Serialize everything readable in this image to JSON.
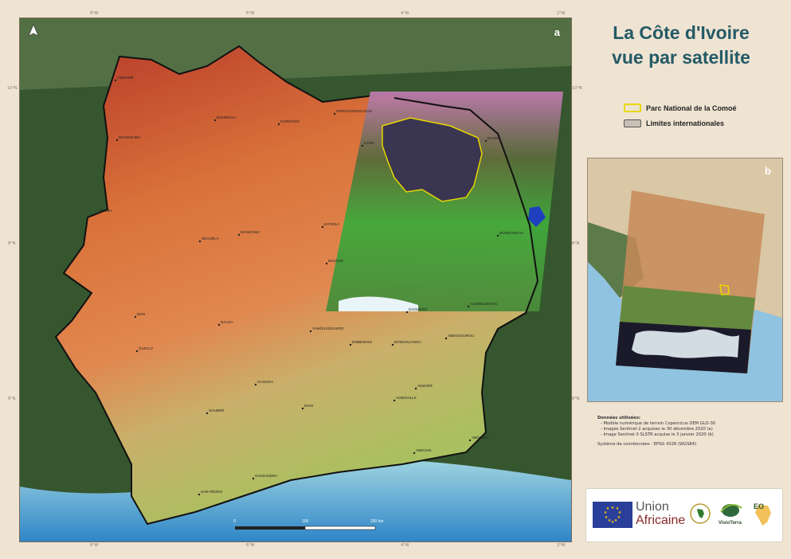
{
  "title": {
    "line1": "La Côte d'Ivoire",
    "line2": "vue par satellite"
  },
  "panel_labels": {
    "main": "a",
    "inset": "b"
  },
  "legend": [
    {
      "label": "Parc National de la Comoé",
      "color": "#e8d800"
    },
    {
      "label": "Limites internationales",
      "color": "#c9c0b5"
    }
  ],
  "graticule": {
    "top": [
      "8°W",
      "6°W",
      "4°W",
      "2°W"
    ],
    "bottom": [
      "8°W",
      "6°W",
      "4°W",
      "2°W"
    ],
    "left": [
      "10°N",
      "8°N",
      "6°N"
    ],
    "right": [
      "10°N",
      "8°N",
      "6°N"
    ]
  },
  "scale_bar": {
    "labels": [
      "0",
      "100",
      "200 km"
    ]
  },
  "towns": [
    "ODIENNÉ",
    "TOUBA",
    "BOUNDIALI",
    "KORHOGO",
    "FERKESSEDOUGOU",
    "KONG",
    "BOUNA",
    "SÉGUÉLA",
    "MANKONO",
    "KATIOLA",
    "BOUAKÉ",
    "BONDOUKOU",
    "MAN",
    "DALOA",
    "YAMOUSSOUKRO",
    "DIMBOKRO",
    "BONGOUANOU",
    "ABENGOUROU",
    "GUIGLO",
    "GAGNOA",
    "AGBOVILLE",
    "ADZOPÉ",
    "DIVO",
    "SOUBRÉ",
    "SAN-PÉDRO",
    "SASSANDRA",
    "ABIDJAN",
    "ABOISSO",
    "AGNIBILEKROU",
    "DAOUKRO",
    "BIANKOUMA"
  ],
  "credits": {
    "heading": "Données utilisées:",
    "lines": [
      "- Modèle numérique de terrain Copernicus DEM GLO-30",
      "- Images Sentinel-2 acquises le 30 décembre 2020 (a)",
      "- Image Sentinel-3 SLSTR acquise le 3 janvier 2020 (b)"
    ],
    "crs": "Système de coordonnées : EPSG 4326 (WGS84)"
  },
  "logos": {
    "union_line1": "Union",
    "union_line2": "Africaine",
    "visioterra": "VisioTerra",
    "eo": "EO"
  },
  "colors": {
    "title": "#245a66",
    "park_outline": "#e8d800",
    "sea": "#3f9ccf",
    "vegetation": "#2f5a2c"
  }
}
